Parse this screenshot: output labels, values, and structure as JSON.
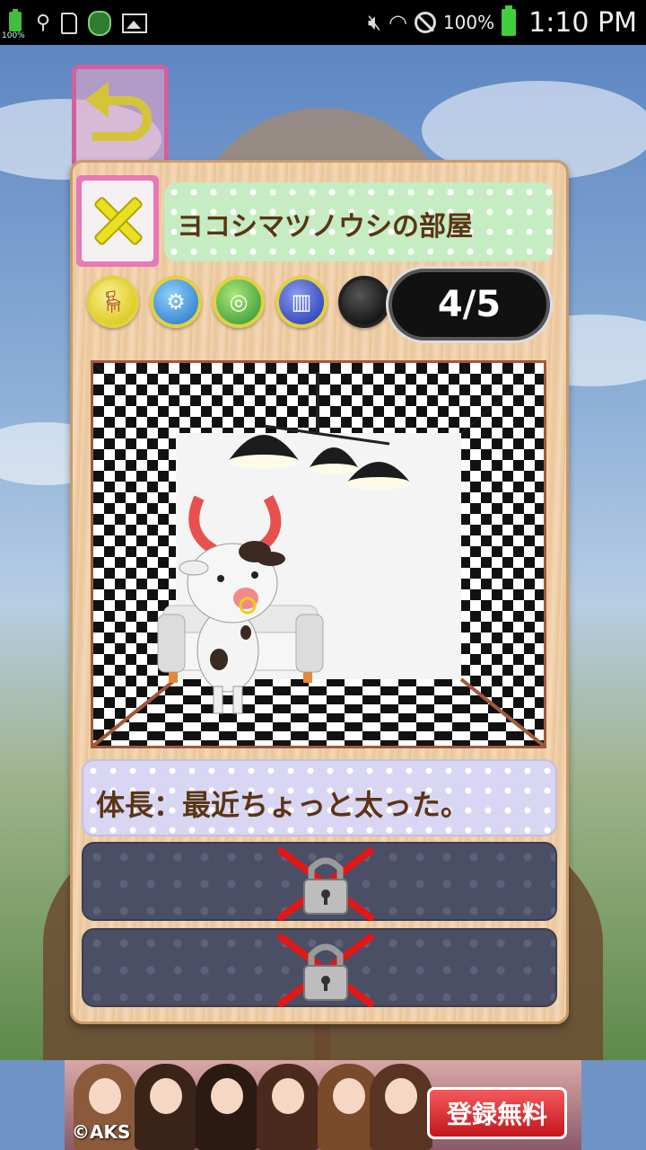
{
  "status_bar": {
    "small_battery_percent": "100%",
    "battery_percent": "100%",
    "time": "1:10 PM",
    "icons": [
      "battery-icon",
      "usb-icon",
      "sd-card-icon",
      "app-logo-icon",
      "image-icon",
      "mute-icon",
      "wifi-icon",
      "blocked-icon",
      "battery-icon"
    ]
  },
  "room": {
    "title": "ヨコシマツノウシの部屋",
    "page_indicator": "4/5",
    "categories": [
      "furniture",
      "ceiling",
      "floor",
      "wall",
      "other"
    ]
  },
  "info": {
    "text": "体長：最近ちょっと太った。"
  },
  "ad": {
    "copyright": "©AKS",
    "cta": "登録無料"
  },
  "colors": {
    "panel": "#f2d3ae",
    "title_plate": "#c5ecc2",
    "info_plate": "#d8d6f2",
    "locked_plate": "#4a4f66",
    "text_brown": "#5a3414",
    "close_pink": "#e878b8",
    "accent_yellow": "#e8e020"
  }
}
